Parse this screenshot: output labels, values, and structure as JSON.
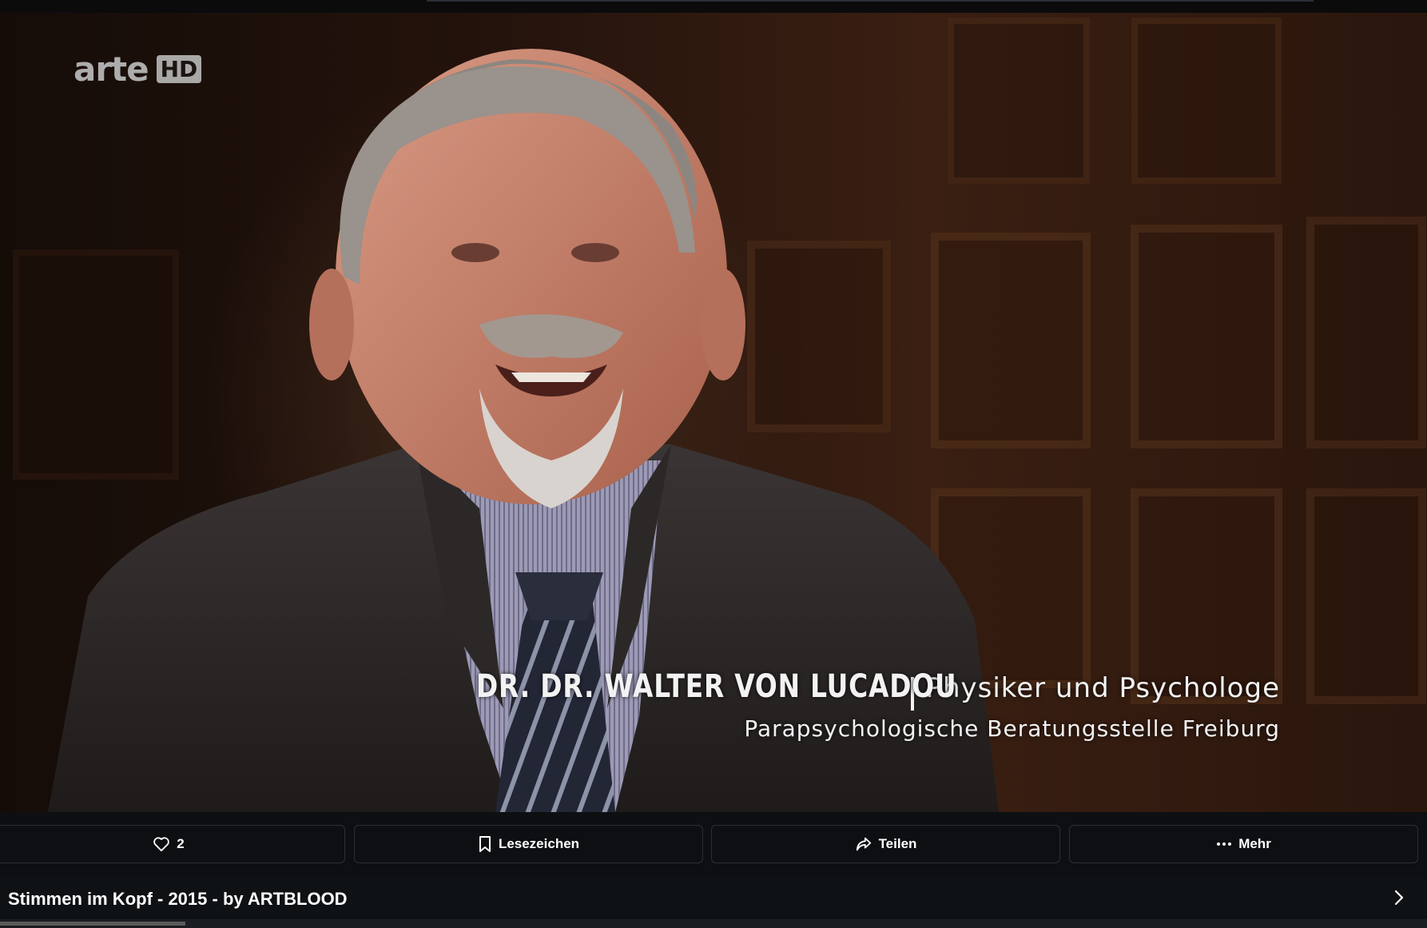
{
  "video": {
    "logo_text": "arte",
    "logo_badge": "HD",
    "lower_third": {
      "name": "DR. DR. WALTER VON LUCADOU",
      "role": "Physiker und Psychologe",
      "affiliation": "Parapsychologische Beratungsstelle Freiburg"
    }
  },
  "actions": [
    {
      "label": "2",
      "icon": "heart-icon"
    },
    {
      "label": "Lesezeichen",
      "icon": "bookmark-icon"
    },
    {
      "label": "Teilen",
      "icon": "share-icon"
    },
    {
      "label": "Mehr",
      "icon": "more-dots-icon"
    }
  ],
  "title": "Stimmen im Kopf - 2015 - by ARTBLOOD",
  "progress_fraction": 0.13
}
